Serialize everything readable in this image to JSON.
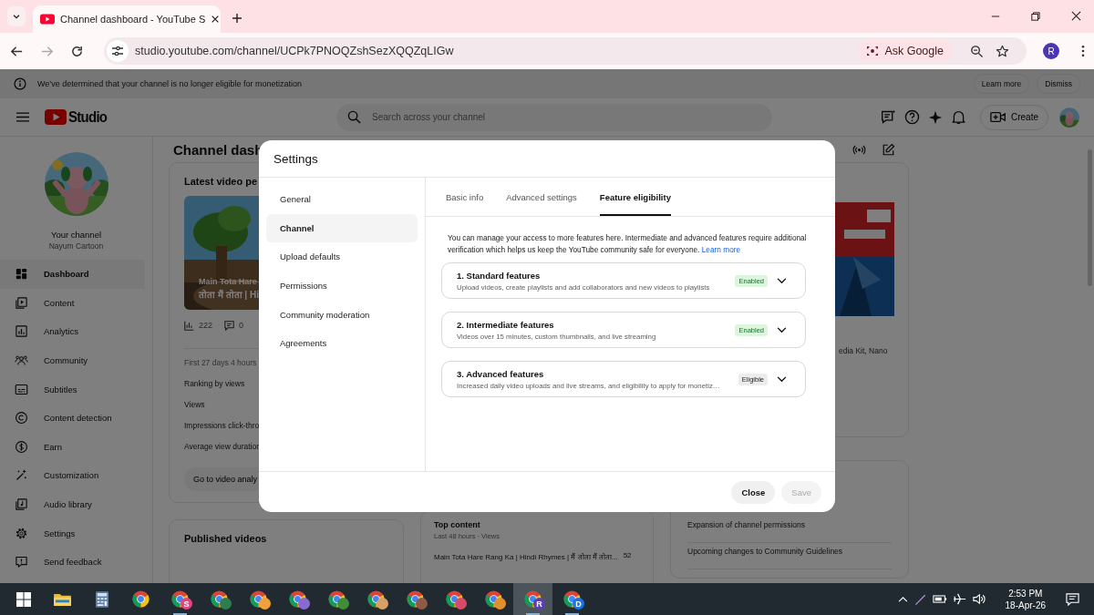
{
  "browser": {
    "tab": {
      "title": "Channel dashboard - YouTube S",
      "selected": true
    },
    "url": "studio.youtube.com/channel/UCPk7PNOQZshSezXQQZqLIGw",
    "ask_google": "Ask Google",
    "profile_initial": "R"
  },
  "banner": {
    "message": "We’ve determined that your channel is no longer eligible for monetization",
    "actions": [
      "Learn more",
      "Dismiss"
    ]
  },
  "studio": {
    "logo": "Studio",
    "search": {
      "placeholder": "Search across your channel"
    },
    "create": "Create"
  },
  "sidebar": {
    "channel_label": "Your channel",
    "channel_name": "Nayum Cartoon",
    "items": [
      {
        "label": "Dashboard",
        "selected": true
      },
      {
        "label": "Content",
        "selected": false
      },
      {
        "label": "Analytics",
        "selected": false
      },
      {
        "label": "Community",
        "selected": false
      },
      {
        "label": "Subtitles",
        "selected": false
      },
      {
        "label": "Content detection",
        "selected": false
      },
      {
        "label": "Earn",
        "selected": false
      },
      {
        "label": "Customization",
        "selected": false
      },
      {
        "label": "Audio library",
        "selected": false
      },
      {
        "label": "Settings",
        "selected": false
      },
      {
        "label": "Send feedback",
        "selected": false
      }
    ]
  },
  "dashboard": {
    "title": "Channel dash",
    "latest_video": {
      "title": "Latest video pe",
      "caption": [
        "Main Tota Hare",
        "तोता मैं तोता | Hi"
      ],
      "views": "222",
      "comments": "0",
      "period": "First 27 days 4 hours",
      "metrics": [
        "Ranking by views",
        "Views",
        "Impressions click-thro",
        "Average view duration"
      ],
      "button": "Go to video analy"
    },
    "published_videos": {
      "title": "Published videos"
    },
    "top_content": {
      "title": "Top content",
      "subtitle": "Last 48 hours · Views",
      "rows": [
        {
          "title": "Main Tota Hare Rang Ka | Hindi Rhymes | मैं तोता मैं तोता...",
          "views": "52"
        }
      ]
    },
    "news": {
      "text": "edia Kit, Nano"
    },
    "updates": [
      "Expansion of channel permissions",
      "Upcoming changes to Community Guidelines"
    ]
  },
  "dialog": {
    "title": "Settings",
    "nav": [
      {
        "label": "General",
        "selected": false
      },
      {
        "label": "Channel",
        "selected": true
      },
      {
        "label": "Upload defaults",
        "selected": false
      },
      {
        "label": "Permissions",
        "selected": false
      },
      {
        "label": "Community moderation",
        "selected": false
      },
      {
        "label": "Agreements",
        "selected": false
      }
    ],
    "tabs": [
      {
        "label": "Basic info",
        "selected": false
      },
      {
        "label": "Advanced settings",
        "selected": false
      },
      {
        "label": "Feature eligibility",
        "selected": true
      }
    ],
    "intro": "You can manage your access to more features here. Intermediate and advanced features require additional verification which helps us keep the YouTube community safe for everyone.",
    "intro_link": "Learn more",
    "features": [
      {
        "title": "1. Standard features",
        "description": "Upload videos, create playlists and add collaborators and new videos to playlists",
        "status": "Enabled",
        "kind": "enabled"
      },
      {
        "title": "2. Intermediate features",
        "description": "Videos over 15 minutes, custom thumbnails, and live streaming",
        "status": "Enabled",
        "kind": "enabled"
      },
      {
        "title": "3. Advanced features",
        "description": "Increased daily video uploads and live streams, and eligibility to apply for monetiz…",
        "status": "Eligible",
        "kind": "eligible"
      }
    ],
    "buttons": [
      {
        "label": "Close",
        "disabled": false
      },
      {
        "label": "Save",
        "disabled": true
      }
    ]
  },
  "taskbar": {
    "apps": [
      {
        "kind": "start",
        "running": false,
        "selected": false
      },
      {
        "kind": "explorer",
        "running": false,
        "selected": false
      },
      {
        "kind": "calculator",
        "running": false,
        "selected": false
      },
      {
        "kind": "chrome",
        "running": false,
        "selected": false
      },
      {
        "kind": "chrome",
        "badge": "S",
        "color": "#e2457e",
        "running": true,
        "selected": false
      },
      {
        "kind": "chrome",
        "color": "#2e7d4f",
        "running": false,
        "selected": false
      },
      {
        "kind": "chrome",
        "color": "#f2a03d",
        "running": false,
        "selected": false
      },
      {
        "kind": "chrome",
        "color": "#8a6ad0",
        "running": false,
        "selected": false
      },
      {
        "kind": "chrome",
        "color": "#3f8c3a",
        "running": false,
        "selected": false
      },
      {
        "kind": "chrome",
        "color": "#d9a066",
        "running": false,
        "selected": false
      },
      {
        "kind": "chrome",
        "color": "#8d5a4a",
        "running": false,
        "selected": false
      },
      {
        "kind": "chrome",
        "color": "#d84a6a",
        "running": false,
        "selected": false
      },
      {
        "kind": "chrome",
        "color": "#e0902e",
        "running": false,
        "selected": false
      },
      {
        "kind": "chrome",
        "badge": "R",
        "color": "#5b3fb5",
        "running": true,
        "selected": true
      },
      {
        "kind": "chrome",
        "badge": "D",
        "color": "#1a73e8",
        "running": true,
        "selected": false
      }
    ],
    "time": "2:53 PM",
    "date": "18-Apr-26"
  }
}
